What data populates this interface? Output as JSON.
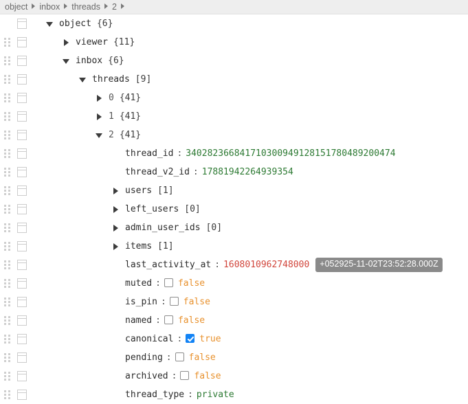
{
  "breadcrumb": {
    "items": [
      "object",
      "inbox",
      "threads",
      "2"
    ],
    "separator_icon": "caret-right-icon"
  },
  "tree": {
    "rows": [
      {
        "depth": 0,
        "toggle": "open",
        "label": "object",
        "label_kind": "key",
        "count": "{6}"
      },
      {
        "depth": 1,
        "toggle": "closed",
        "label": "viewer",
        "label_kind": "key",
        "count": "{11}"
      },
      {
        "depth": 1,
        "toggle": "open",
        "label": "inbox",
        "label_kind": "key",
        "count": "{6}"
      },
      {
        "depth": 2,
        "toggle": "open",
        "label": "threads",
        "label_kind": "key",
        "count": "[9]"
      },
      {
        "depth": 3,
        "toggle": "closed",
        "label": "0",
        "label_kind": "index",
        "count": "{41}"
      },
      {
        "depth": 3,
        "toggle": "closed",
        "label": "1",
        "label_kind": "index",
        "count": "{41}"
      },
      {
        "depth": 3,
        "toggle": "open",
        "label": "2",
        "label_kind": "index",
        "count": "{41}"
      },
      {
        "depth": 4,
        "toggle": "none",
        "label": "thread_id",
        "label_kind": "key",
        "colon": ":",
        "value": "340282366841710300949128151780489200474",
        "value_kind": "string"
      },
      {
        "depth": 4,
        "toggle": "none",
        "label": "thread_v2_id",
        "label_kind": "key",
        "colon": ":",
        "value": "17881942264939354",
        "value_kind": "string"
      },
      {
        "depth": 4,
        "toggle": "closed",
        "label": "users",
        "label_kind": "key",
        "count": "[1]"
      },
      {
        "depth": 4,
        "toggle": "closed",
        "label": "left_users",
        "label_kind": "key",
        "count": "[0]"
      },
      {
        "depth": 4,
        "toggle": "closed",
        "label": "admin_user_ids",
        "label_kind": "key",
        "count": "[0]"
      },
      {
        "depth": 4,
        "toggle": "closed",
        "label": "items",
        "label_kind": "key",
        "count": "[1]"
      },
      {
        "depth": 4,
        "toggle": "none",
        "label": "last_activity_at",
        "label_kind": "key",
        "colon": ":",
        "value": "1608010962748000",
        "value_kind": "number",
        "badge": "+052925-11-02T23:52:28.000Z"
      },
      {
        "depth": 4,
        "toggle": "none",
        "label": "muted",
        "label_kind": "key",
        "colon": ":",
        "value": "false",
        "value_kind": "boolean",
        "checked": false
      },
      {
        "depth": 4,
        "toggle": "none",
        "label": "is_pin",
        "label_kind": "key",
        "colon": ":",
        "value": "false",
        "value_kind": "boolean",
        "checked": false
      },
      {
        "depth": 4,
        "toggle": "none",
        "label": "named",
        "label_kind": "key",
        "colon": ":",
        "value": "false",
        "value_kind": "boolean",
        "checked": false
      },
      {
        "depth": 4,
        "toggle": "none",
        "label": "canonical",
        "label_kind": "key",
        "colon": ":",
        "value": "true",
        "value_kind": "boolean",
        "checked": true
      },
      {
        "depth": 4,
        "toggle": "none",
        "label": "pending",
        "label_kind": "key",
        "colon": ":",
        "value": "false",
        "value_kind": "boolean",
        "checked": false
      },
      {
        "depth": 4,
        "toggle": "none",
        "label": "archived",
        "label_kind": "key",
        "colon": ":",
        "value": "false",
        "value_kind": "boolean",
        "checked": false
      },
      {
        "depth": 4,
        "toggle": "none",
        "label": "thread_type",
        "label_kind": "key",
        "colon": ":",
        "value": "private",
        "value_kind": "string"
      }
    ],
    "row_icons": {
      "drag_handle": "drag-dots-icon",
      "card": "card-icon",
      "toggle_open": "caret-down-icon",
      "toggle_closed": "caret-right-icon"
    }
  },
  "colors": {
    "breadcrumb_bg": "#eeeeee",
    "breadcrumb_text": "#6a6a6a",
    "string": "#2d7a33",
    "number": "#d1453b",
    "boolean": "#e8912d",
    "checkbox_checked": "#1283f5",
    "badge_bg": "#8a8a8a"
  }
}
